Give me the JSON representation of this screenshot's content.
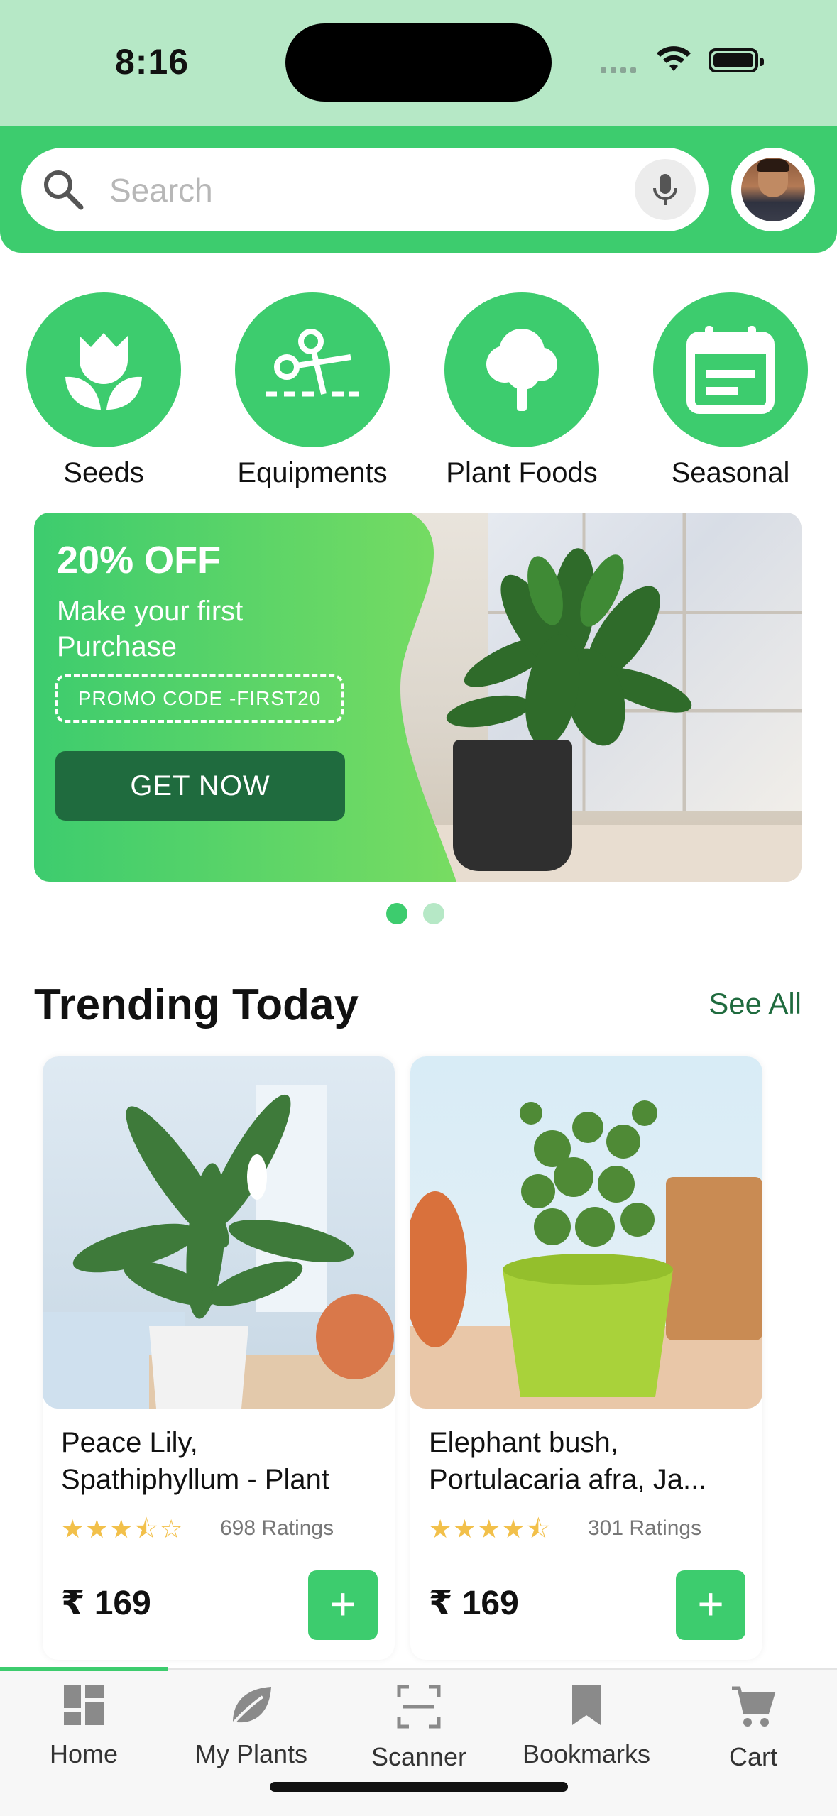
{
  "status_bar": {
    "time": "8:16"
  },
  "search": {
    "placeholder": "Search"
  },
  "categories": [
    {
      "label": "Seeds",
      "icon": "tulip-icon"
    },
    {
      "label": "Equipments",
      "icon": "scissors-icon"
    },
    {
      "label": "Plant Foods",
      "icon": "tree-icon"
    },
    {
      "label": "Seasonal",
      "icon": "calendar-icon"
    }
  ],
  "banner": {
    "discount": "20% OFF",
    "subtitle": "Make your first Purchase",
    "promo": "PROMO CODE -FIRST20",
    "cta": "GET NOW",
    "active_slide": 1,
    "total_slides": 2
  },
  "trending": {
    "title": "Trending Today",
    "see_all": "See All",
    "products": [
      {
        "name_line1": "Peace Lily,",
        "name_line2": "Spathiphyllum - Plant",
        "rating": 3.5,
        "ratings": "698 Ratings",
        "price": "₹ 169"
      },
      {
        "name_line1": "Elephant bush,",
        "name_line2": "Portulacaria afra, Ja...",
        "rating": 4.5,
        "ratings": "301 Ratings",
        "price": "₹ 169"
      }
    ]
  },
  "tabs": [
    {
      "label": "Home",
      "icon": "grid-icon",
      "active": true
    },
    {
      "label": "My Plants",
      "icon": "leaf-icon",
      "active": false
    },
    {
      "label": "Scanner",
      "icon": "scan-icon",
      "active": false
    },
    {
      "label": "Bookmarks",
      "icon": "bookmark-icon",
      "active": false
    },
    {
      "label": "Cart",
      "icon": "cart-icon",
      "active": false
    }
  ],
  "colors": {
    "primary": "#3dcc6e",
    "dark_green": "#1f6b3e",
    "status_bar": "#b6e8c6",
    "star": "#f2c04a"
  }
}
